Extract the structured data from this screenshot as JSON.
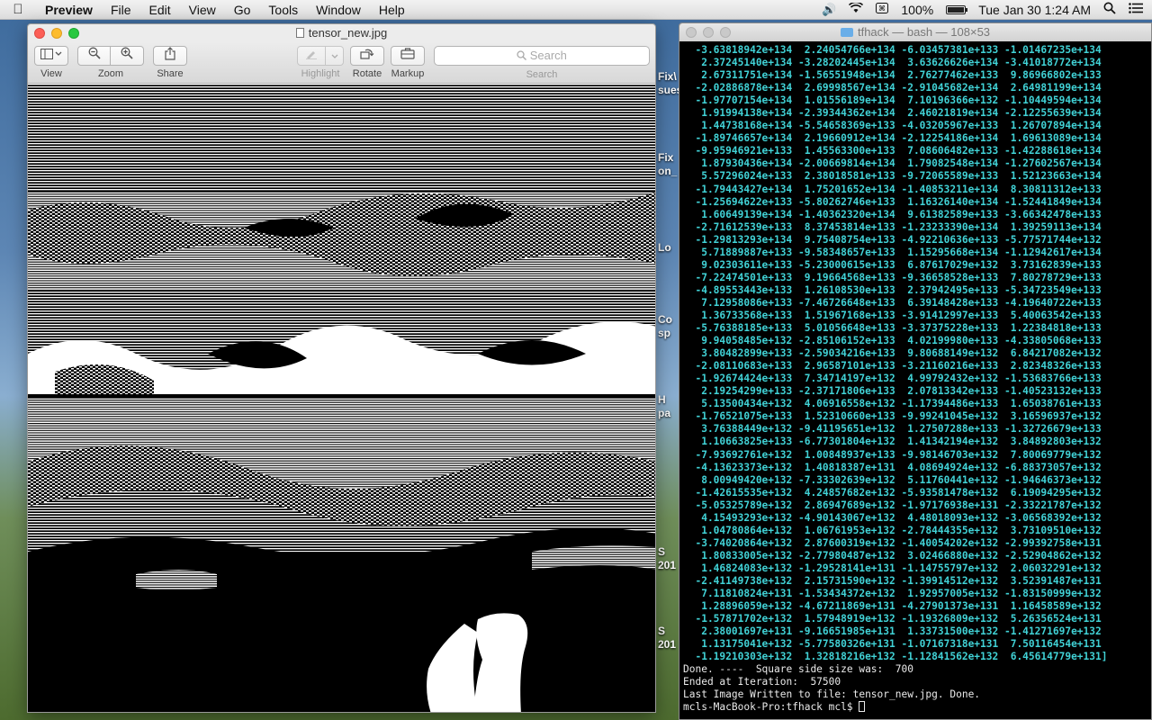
{
  "menubar": {
    "app_name": "Preview",
    "menus": [
      "File",
      "Edit",
      "View",
      "Go",
      "Tools",
      "Window",
      "Help"
    ],
    "battery_percent": "100%",
    "clock": "Tue Jan 30  1:24 AM",
    "battery_level": 1.0
  },
  "desktop": {
    "labels": [
      "Fix\\",
      "sues",
      "Fix",
      "on_",
      "Lo",
      "Co",
      "sp",
      "H",
      "pa",
      "S",
      "201",
      "S",
      "201"
    ]
  },
  "preview": {
    "title": "tensor_new.jpg",
    "toolbar": {
      "view_label": "View",
      "zoom_label": "Zoom",
      "share_label": "Share",
      "highlight_label": "Highlight",
      "rotate_label": "Rotate",
      "markup_label": "Markup",
      "search_placeholder": "Search",
      "search_label": "Search"
    }
  },
  "terminal": {
    "title": "tfhack — bash — 108×53",
    "output_lines": [
      "  -3.63818942e+134  2.24054766e+134 -6.03457381e+133 -1.01467235e+134",
      "   2.37245140e+134 -3.28202445e+134  3.63626626e+134 -3.41018772e+134",
      "   2.67311751e+134 -1.56551948e+134  2.76277462e+133  9.86966802e+133",
      "  -2.02886878e+134  2.69998567e+134 -2.91045682e+134  2.64981199e+134",
      "  -1.97707154e+134  1.01556189e+134  7.10196366e+132 -1.10449594e+134",
      "   1.91994138e+134 -2.39344362e+134  2.46021819e+134 -2.12255639e+134",
      "   1.44738168e+134 -5.54658369e+133 -4.03205967e+133  1.26707894e+134",
      "  -1.89746657e+134  2.19660912e+134 -2.12254186e+134  1.69613089e+134",
      "  -9.95946921e+133  1.45563300e+133  7.08606482e+133 -1.42288618e+134",
      "   1.87930436e+134 -2.00669814e+134  1.79082548e+134 -1.27602567e+134",
      "   5.57296024e+133  2.38018581e+133 -9.72065589e+133  1.52123663e+134",
      "  -1.79443427e+134  1.75201652e+134 -1.40853211e+134  8.30811312e+133",
      "  -1.25694622e+133 -5.80262746e+133  1.16326140e+134 -1.52441849e+134",
      "   1.60649139e+134 -1.40362320e+134  9.61382589e+133 -3.66342478e+133",
      "  -2.71612539e+133  8.37453814e+133 -1.23233390e+134  1.39259113e+134",
      "  -1.29813293e+134  9.75408754e+133 -4.92210636e+133 -5.77571744e+132",
      "   5.71889887e+133 -9.58348657e+133  1.15295668e+134 -1.12942617e+134",
      "   9.02303611e+133 -5.23000615e+133  6.87617029e+132  3.73162839e+133",
      "  -7.22474501e+133  9.19664568e+133 -9.36658528e+133  7.80278729e+133",
      "  -4.89553443e+133  1.26108530e+133  2.37942495e+133 -5.34723549e+133",
      "   7.12958086e+133 -7.46726648e+133  6.39148428e+133 -4.19640722e+133",
      "   1.36733568e+133  1.51967168e+133 -3.91412997e+133  5.40063542e+133",
      "  -5.76388185e+133  5.01056648e+133 -3.37375228e+133  1.22384818e+133",
      "   9.94058485e+132 -2.85106152e+133  4.02199980e+133 -4.33805068e+133",
      "   3.80482899e+133 -2.59034216e+133  9.80688149e+132  6.84217082e+132",
      "  -2.08110683e+133  2.96587101e+133 -3.21160216e+133  2.82348326e+133",
      "  -1.92674424e+133  7.34714197e+132  4.99792432e+132 -1.53683766e+133",
      "   2.19254299e+133 -2.37171806e+133  2.07813342e+133 -1.40523132e+133",
      "   5.13500434e+132  4.06916558e+132 -1.17394486e+133  1.65038761e+133",
      "  -1.76521075e+133  1.52310660e+133 -9.99241045e+132  3.16596937e+132",
      "   3.76388449e+132 -9.41195651e+132  1.27507288e+133 -1.32726679e+133",
      "   1.10663825e+133 -6.77301804e+132  1.41342194e+132  3.84892803e+132",
      "  -7.93692761e+132  1.00848937e+133 -9.98146703e+132  7.80069779e+132",
      "  -4.13623373e+132  1.40818387e+131  4.08694924e+132 -6.88373057e+132",
      "   8.00949420e+132 -7.33302639e+132  5.11760441e+132 -1.94646373e+132",
      "  -1.42615535e+132  4.24857682e+132 -5.93581478e+132  6.19094295e+132",
      "  -5.05325789e+132  2.86947689e+132 -1.97176938e+131 -2.33221787e+132",
      "   4.15493293e+132 -4.90143067e+132  4.48018093e+132 -3.06568392e+132",
      "   1.04780864e+132  1.06761953e+132 -2.78444355e+132  3.73109510e+132",
      "  -3.74020864e+132  2.87600319e+132 -1.40054202e+132 -2.99392758e+131",
      "   1.80833005e+132 -2.77980487e+132  3.02466880e+132 -2.52904862e+132",
      "   1.46824083e+132 -1.29528141e+131 -1.14755797e+132  2.06032291e+132",
      "  -2.41149738e+132  2.15731590e+132 -1.39914512e+132  3.52391487e+131",
      "   7.11810824e+131 -1.53434372e+132  1.92957005e+132 -1.83150999e+132",
      "   1.28896059e+132 -4.67211869e+131 -4.27901373e+131  1.16458589e+132",
      "  -1.57871702e+132  1.57948919e+132 -1.19326809e+132  5.26356524e+131",
      "   2.38001697e+131 -9.16651985e+131  1.33731500e+132 -1.41271697e+132",
      "   1.13175041e+132 -5.77580326e+131 -1.07167318e+131  7.50116454e+131",
      "  -1.19210303e+132  1.32818216e+132 -1.12841562e+132  6.45614779e+131]"
    ],
    "status_lines": [
      "Done. ----  Square side size was:  700",
      "Ended at Iteration:  57500",
      "Last Image Written to file: tensor_new.jpg. Done."
    ],
    "prompt": "mcls-MacBook-Pro:tfhack mcl$ "
  }
}
